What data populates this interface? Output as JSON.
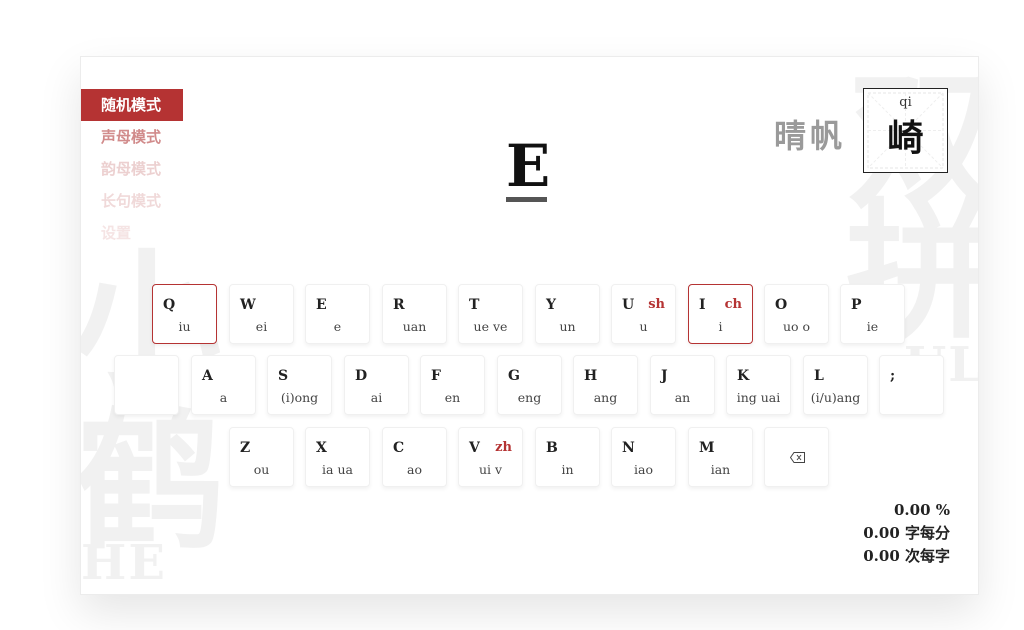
{
  "background_chars": {
    "left": [
      "小",
      "鹤"
    ],
    "left_latin": "HE",
    "right": [
      "双",
      "拼"
    ],
    "right_latin": "UL"
  },
  "menu": {
    "items": [
      {
        "label": "随机模式",
        "active": true
      },
      {
        "label": "声母模式",
        "active": false
      },
      {
        "label": "韵母模式",
        "active": false
      },
      {
        "label": "长句模式",
        "active": false
      },
      {
        "label": "设置",
        "active": false
      }
    ]
  },
  "target": {
    "letter": "E"
  },
  "word": {
    "preceding": "晴帆",
    "current_hanzi": "崎",
    "current_pinyin": "qi"
  },
  "keyboard": {
    "row1": [
      {
        "letter": "Q",
        "final": "iu",
        "shengmu": "",
        "highlighted": true
      },
      {
        "letter": "W",
        "final": "ei",
        "shengmu": "",
        "highlighted": false
      },
      {
        "letter": "E",
        "final": "e",
        "shengmu": "",
        "highlighted": false
      },
      {
        "letter": "R",
        "final": "uan",
        "shengmu": "",
        "highlighted": false
      },
      {
        "letter": "T",
        "final": "ue ve",
        "shengmu": "",
        "highlighted": false
      },
      {
        "letter": "Y",
        "final": "un",
        "shengmu": "",
        "highlighted": false
      },
      {
        "letter": "U",
        "final": "u",
        "shengmu": "sh",
        "highlighted": false
      },
      {
        "letter": "I",
        "final": "i",
        "shengmu": "ch",
        "highlighted": true
      },
      {
        "letter": "O",
        "final": "uo o",
        "shengmu": "",
        "highlighted": false
      },
      {
        "letter": "P",
        "final": "ie",
        "shengmu": "",
        "highlighted": false
      }
    ],
    "row2": [
      {
        "letter": "",
        "final": "",
        "shengmu": "",
        "highlighted": false
      },
      {
        "letter": "A",
        "final": "a",
        "shengmu": "",
        "highlighted": false
      },
      {
        "letter": "S",
        "final": "(i)ong",
        "shengmu": "",
        "highlighted": false
      },
      {
        "letter": "D",
        "final": "ai",
        "shengmu": "",
        "highlighted": false
      },
      {
        "letter": "F",
        "final": "en",
        "shengmu": "",
        "highlighted": false
      },
      {
        "letter": "G",
        "final": "eng",
        "shengmu": "",
        "highlighted": false
      },
      {
        "letter": "H",
        "final": "ang",
        "shengmu": "",
        "highlighted": false
      },
      {
        "letter": "J",
        "final": "an",
        "shengmu": "",
        "highlighted": false
      },
      {
        "letter": "K",
        "final": "ing uai",
        "shengmu": "",
        "highlighted": false
      },
      {
        "letter": "L",
        "final": "(i/u)ang",
        "shengmu": "",
        "highlighted": false
      },
      {
        "letter": ";",
        "final": "",
        "shengmu": "",
        "highlighted": false
      }
    ],
    "row3": [
      {
        "letter": "Z",
        "final": "ou",
        "shengmu": "",
        "highlighted": false
      },
      {
        "letter": "X",
        "final": "ia ua",
        "shengmu": "",
        "highlighted": false
      },
      {
        "letter": "C",
        "final": "ao",
        "shengmu": "",
        "highlighted": false
      },
      {
        "letter": "V",
        "final": "ui v",
        "shengmu": "zh",
        "highlighted": false
      },
      {
        "letter": "B",
        "final": "in",
        "shengmu": "",
        "highlighted": false
      },
      {
        "letter": "N",
        "final": "iao",
        "shengmu": "",
        "highlighted": false
      },
      {
        "letter": "M",
        "final": "ian",
        "shengmu": "",
        "highlighted": false
      },
      {
        "letter": "",
        "final": "",
        "shengmu": "",
        "highlighted": false,
        "icon": "backspace-icon"
      }
    ]
  },
  "stats": {
    "accuracy": "0.00 %",
    "speed": "0.00 字每分",
    "keystrokes": "0.00 次每字"
  },
  "colors": {
    "accent": "#b53333",
    "text": "#222222",
    "muted": "#9a9a9a"
  }
}
